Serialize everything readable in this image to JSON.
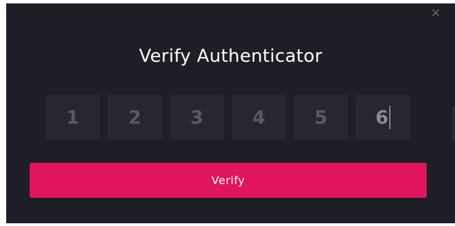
{
  "dialog": {
    "title": "Verify Authenticator",
    "close_glyph": "×",
    "close_icon": "close-icon",
    "code_digits": [
      "1",
      "2",
      "3",
      "4",
      "5",
      "6"
    ],
    "verify_label": "Verify"
  },
  "colors": {
    "background": "#1e1e26",
    "input_box": "#272730",
    "accent": "#e0155d",
    "text": "#ffffff"
  }
}
